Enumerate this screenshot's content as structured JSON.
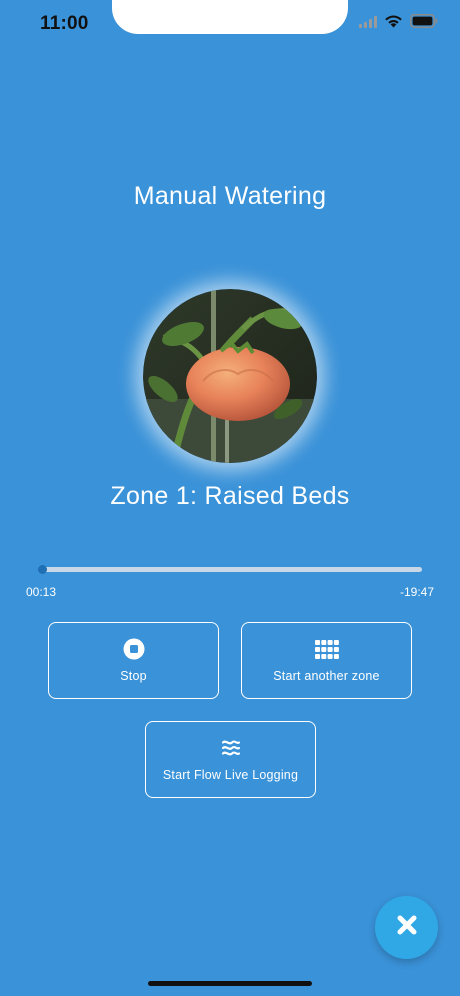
{
  "status_bar": {
    "time": "11:00"
  },
  "screen": {
    "title": "Manual Watering",
    "zone_name": "Zone 1: Raised Beds"
  },
  "progress": {
    "elapsed": "00:13",
    "remaining": "-19:47",
    "fraction": 0.011
  },
  "actions": {
    "stop_label": "Stop",
    "start_another_label": "Start another zone",
    "flow_logging_label": "Start Flow Live Logging"
  },
  "icons": {
    "stop": "stop-circle-icon",
    "zones": "grid-icon",
    "flow": "waves-icon",
    "close": "close-icon",
    "signal": "signal-icon",
    "wifi": "wifi-icon",
    "battery": "battery-icon"
  },
  "colors": {
    "background": "#3a92d8",
    "fab": "#31a8e6",
    "text": "#ffffff"
  }
}
